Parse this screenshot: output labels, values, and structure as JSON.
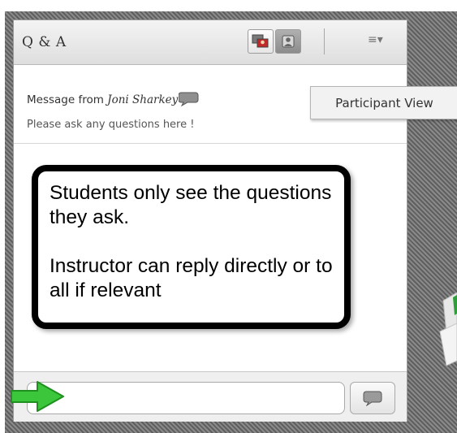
{
  "panel": {
    "title": "Q & A",
    "host_view_icon": "host-view-icon",
    "participant_view_icon": "participant-view-icon",
    "menu_icon": "≡▾"
  },
  "message": {
    "prefix": "Message from ",
    "sender": "Joni Sharkey",
    "body": "Please ask any questions here !"
  },
  "tooltip": {
    "text": "Participant View"
  },
  "annotation": {
    "line1": "Students only see the questions they ask.",
    "line2": "Instructor can reply directly or to all if relevant"
  },
  "input": {
    "value": "",
    "placeholder": ""
  },
  "colors": {
    "arrow": "#3cc63c",
    "background_stripes": "#6f6f6f"
  }
}
